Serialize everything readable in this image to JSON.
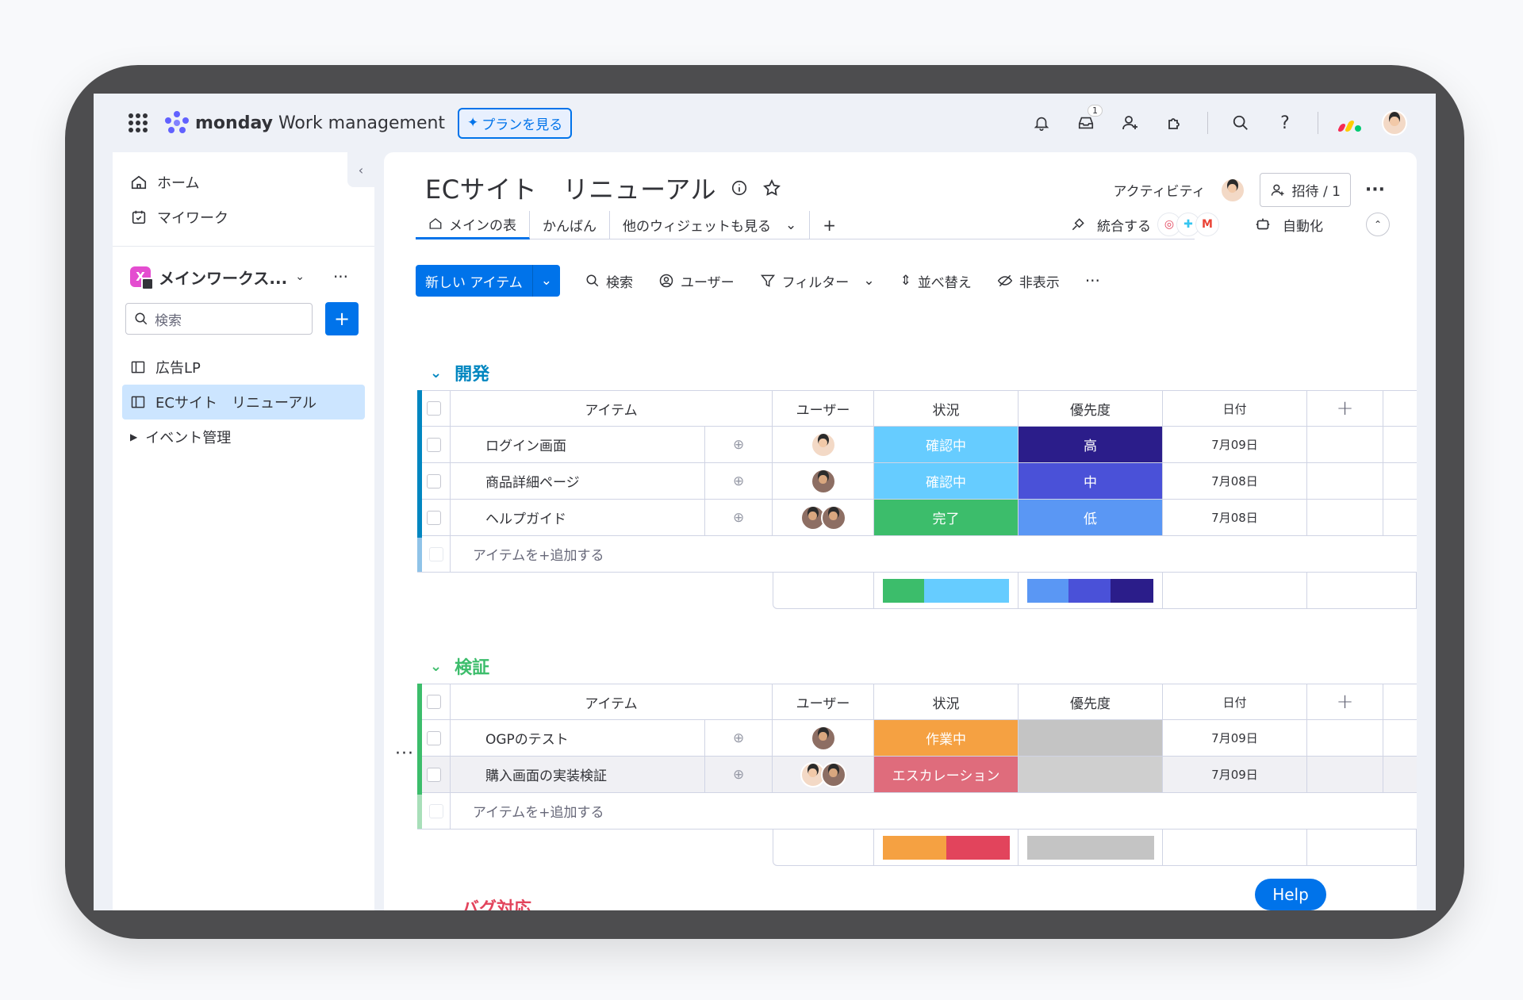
{
  "topbar": {
    "brand": "monday",
    "product": "Work management",
    "plan_button": "プランを見る",
    "inbox_badge": "1"
  },
  "sidebar": {
    "home": "ホーム",
    "my_work": "マイワーク",
    "workspace": "メインワークス...",
    "workspace_icon": "X",
    "search_placeholder": "検索",
    "boards": [
      "広告LP",
      "ECサイト　リニューアル"
    ],
    "folder": "イベント管理"
  },
  "board": {
    "title": "ECサイト　リニューアル",
    "activity": "アクティビティ",
    "invite": "招待 / 1",
    "tabs": [
      "メインの表",
      "かんばん",
      "他のウィジェットも見る"
    ],
    "integrate": "統合する",
    "automate": "自動化"
  },
  "toolbar": {
    "new_item": "新しい アイテム",
    "search": "検索",
    "user": "ユーザー",
    "filter": "フィルター",
    "sort": "並べ替え",
    "hide": "非表示"
  },
  "columns": {
    "item": "アイテム",
    "user": "ユーザー",
    "status": "状況",
    "priority": "優先度",
    "date": "日付"
  },
  "groups": [
    {
      "title": "開発",
      "color": "#0086c0",
      "add_item": "アイテムを+追加する",
      "rows": [
        {
          "name": "ログイン画面",
          "status": "確認中",
          "status_color": "#66ccff",
          "priority": "高",
          "priority_color": "#2b1d8a",
          "date": "7月09日"
        },
        {
          "name": "商品詳細ページ",
          "status": "確認中",
          "status_color": "#66ccff",
          "priority": "中",
          "priority_color": "#4a51d8",
          "date": "7月08日"
        },
        {
          "name": "ヘルプガイド",
          "status": "完了",
          "status_color": "#3cbd6b",
          "priority": "低",
          "priority_color": "#5a97f4",
          "date": "7月08日"
        }
      ]
    },
    {
      "title": "検証",
      "color": "#3cbd6b",
      "add_item": "アイテムを+追加する",
      "rows": [
        {
          "name": "OGPのテスト",
          "status": "作業中",
          "status_color": "#f5a142",
          "priority": "",
          "priority_color": "#c4c4c4",
          "date": "7月09日"
        },
        {
          "name": "購入画面の実装検証",
          "status": "エスカレーション",
          "status_color": "#df6c7c",
          "priority": "",
          "priority_color": "#cfcfcf",
          "date": "7月09日"
        }
      ]
    }
  ],
  "next_group_title": "バグ対応",
  "help": "Help"
}
